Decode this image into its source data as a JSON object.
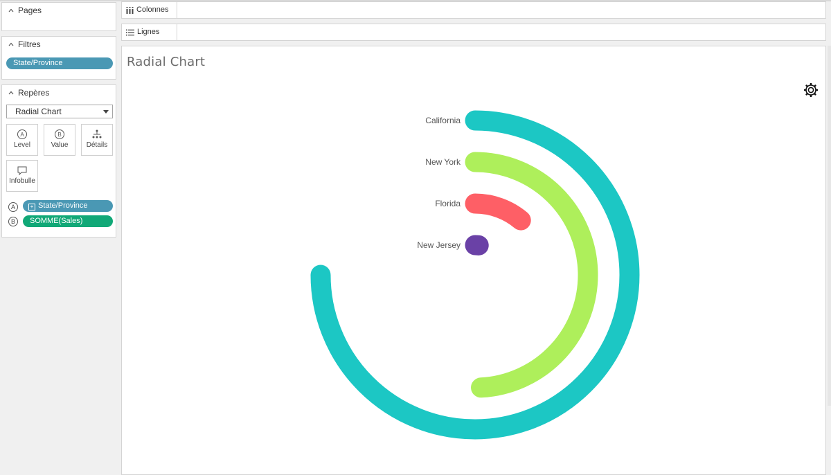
{
  "left_panel": {
    "pages": {
      "title": "Pages"
    },
    "filters": {
      "title": "Filtres",
      "pill": "State/Province"
    },
    "marks": {
      "title": "Repères",
      "mark_type": "Radial Chart",
      "buttons": [
        {
          "label": "Level",
          "icon": "circle-a-icon"
        },
        {
          "label": "Value",
          "icon": "circle-b-icon"
        },
        {
          "label": "Détails",
          "icon": "details-icon"
        },
        {
          "label": "Infobulle",
          "icon": "tooltip-icon"
        }
      ],
      "fields": [
        {
          "letter": "A",
          "label": "State/Province",
          "color": "#4a98b4"
        },
        {
          "letter": "B",
          "label": "SOMME(Sales)",
          "color": "#11a877"
        }
      ]
    }
  },
  "shelves": {
    "columns": {
      "label": "Colonnes",
      "icon": "columns-icon"
    },
    "rows": {
      "label": "Lignes",
      "icon": "rows-icon"
    }
  },
  "viz": {
    "title": "Radial Chart"
  },
  "chart_data": {
    "type": "radial-bar",
    "title": "Radial Chart",
    "categories": [
      "California",
      "New York",
      "Florida",
      "New Jersey"
    ],
    "values": [
      270,
      177,
      40,
      7
    ],
    "value_unit": "degrees of arc (relative Sales)",
    "colors": [
      "#1cc7c4",
      "#aeef5b",
      "#fe5f66",
      "#6a41a6"
    ],
    "start_angle": 0,
    "direction": "clockwise",
    "max_angle": 360
  }
}
